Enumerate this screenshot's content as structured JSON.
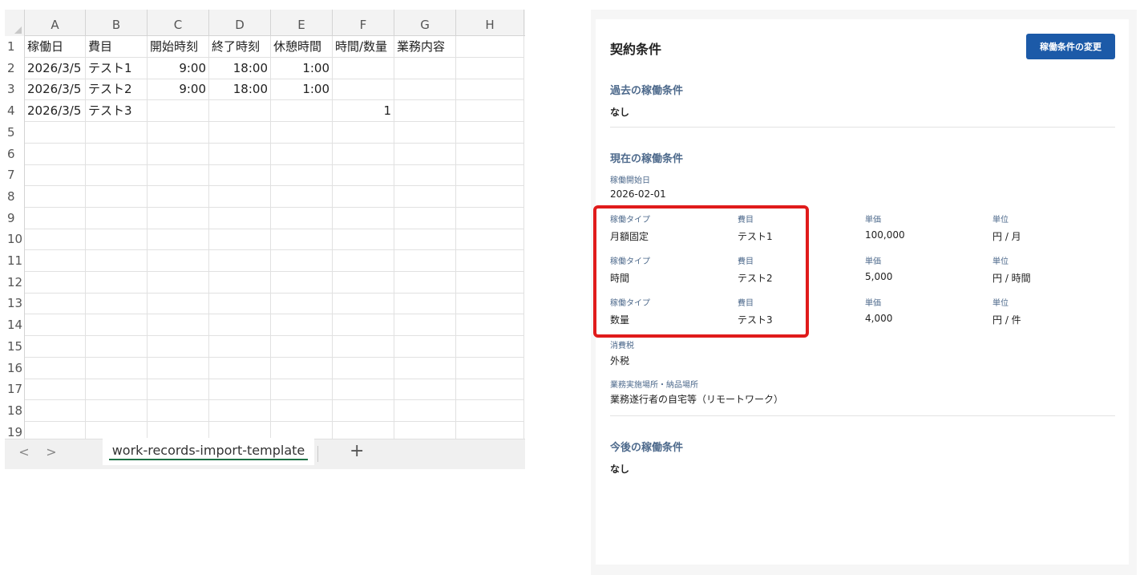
{
  "spreadsheet": {
    "columns": [
      "A",
      "B",
      "C",
      "D",
      "E",
      "F",
      "G",
      "H"
    ],
    "row_numbers": [
      "1",
      "2",
      "3",
      "4",
      "5",
      "6",
      "7",
      "8",
      "9",
      "10",
      "11",
      "12",
      "13",
      "14",
      "15",
      "16",
      "17",
      "18",
      "19"
    ],
    "rows": [
      [
        "稼働日",
        "費目",
        "開始時刻",
        "終了時刻",
        "休憩時間",
        "時間/数量",
        "業務内容",
        ""
      ],
      [
        "2026/3/5",
        "テスト1",
        "9:00",
        "18:00",
        "1:00",
        "",
        "",
        ""
      ],
      [
        "2026/3/5",
        "テスト2",
        "9:00",
        "18:00",
        "1:00",
        "",
        "",
        ""
      ],
      [
        "2026/3/5",
        "テスト3",
        "",
        "",
        "",
        "1",
        "",
        ""
      ]
    ],
    "sheet_tab": "work-records-import-template",
    "nav_prev": "<",
    "nav_next": ">",
    "add_sheet": "+"
  },
  "contract": {
    "title": "契約条件",
    "change_button": "稼働条件の変更",
    "past": {
      "heading": "過去の稼働条件",
      "value": "なし"
    },
    "current": {
      "heading": "現在の稼働条件",
      "start_date_label": "稼働開始日",
      "start_date": "2026-02-01",
      "items": [
        {
          "type_label": "稼働タイプ",
          "type": "月額固定",
          "expense_label": "費目",
          "expense": "テスト1",
          "price_label": "単価",
          "price": "100,000",
          "unit_label": "単位",
          "unit": "円 / 月"
        },
        {
          "type_label": "稼働タイプ",
          "type": "時間",
          "expense_label": "費目",
          "expense": "テスト2",
          "price_label": "単価",
          "price": "5,000",
          "unit_label": "単位",
          "unit": "円 / 時間"
        },
        {
          "type_label": "稼働タイプ",
          "type": "数量",
          "expense_label": "費目",
          "expense": "テスト3",
          "price_label": "単価",
          "price": "4,000",
          "unit_label": "単位",
          "unit": "円 / 件"
        }
      ],
      "tax_label": "消費税",
      "tax": "外税",
      "location_label": "業務実施場所・納品場所",
      "location": "業務遂行者の自宅等（リモートワーク）"
    },
    "future": {
      "heading": "今後の稼働条件",
      "value": "なし"
    }
  },
  "colors": {
    "button": "#1c5aa8",
    "highlight": "#e01b1b",
    "section_heading": "#4e6a8c",
    "sheet_tab_underline": "#1e7145"
  }
}
